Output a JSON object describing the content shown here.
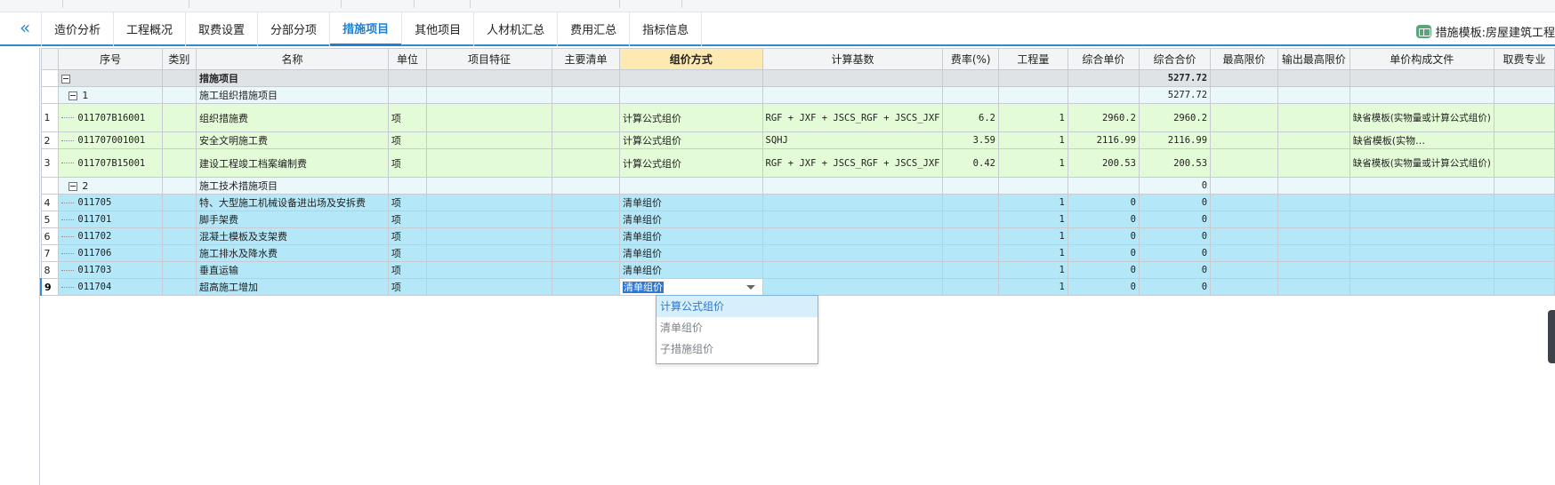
{
  "tabs": [
    {
      "label": "造价分析"
    },
    {
      "label": "工程概况"
    },
    {
      "label": "取费设置"
    },
    {
      "label": "分部分项"
    },
    {
      "label": "措施项目",
      "active": true
    },
    {
      "label": "其他项目"
    },
    {
      "label": "人材机汇总"
    },
    {
      "label": "费用汇总"
    },
    {
      "label": "指标信息"
    }
  ],
  "collapse_glyph": "«",
  "template_label": "措施模板:房屋建筑工程",
  "columns": {
    "seq": "序号",
    "category": "类别",
    "name": "名称",
    "unit": "单位",
    "feature": "项目特征",
    "main_list": "主要清单",
    "pricing": "组价方式",
    "base": "计算基数",
    "rate": "费率(%)",
    "qty": "工程量",
    "unit_price": "综合单价",
    "total": "综合合价",
    "max_limit": "最高限价",
    "out_max_limit": "输出最高限价",
    "composition": "单价构成文件",
    "fee_major": "取费专业"
  },
  "rows": {
    "root": {
      "name": "措施项目",
      "total": "5277.72"
    },
    "g1": {
      "code": "1",
      "name": "施工组织措施项目",
      "total": "5277.72"
    },
    "r1": {
      "idx": "1",
      "code": "011707B16001",
      "name": "组织措施费",
      "unit": "项",
      "pricing": "计算公式组价",
      "base": "RGF + JXF + JSCS_RGF + JSCS_JXF",
      "rate": "6.2",
      "qty": "1",
      "unit_price": "2960.2",
      "total": "2960.2",
      "composition": "缺省模板(实物量或计算公式组价)"
    },
    "r2": {
      "idx": "2",
      "code": "011707001001",
      "name": "安全文明施工费",
      "unit": "项",
      "pricing": "计算公式组价",
      "base": "SQHJ",
      "rate": "3.59",
      "qty": "1",
      "unit_price": "2116.99",
      "total": "2116.99",
      "composition": "缺省模板(实物…"
    },
    "r3": {
      "idx": "3",
      "code": "011707B15001",
      "name": "建设工程竣工档案编制费",
      "unit": "项",
      "pricing": "计算公式组价",
      "base": "RGF + JXF + JSCS_RGF + JSCS_JXF",
      "rate": "0.42",
      "qty": "1",
      "unit_price": "200.53",
      "total": "200.53",
      "composition": "缺省模板(实物量或计算公式组价)"
    },
    "g2": {
      "code": "2",
      "name": "施工技术措施项目",
      "total": "0"
    },
    "r4": {
      "idx": "4",
      "code": "011705",
      "name": "特、大型施工机械设备进出场及安拆费",
      "unit": "项",
      "pricing": "清单组价",
      "qty": "1",
      "unit_price": "0",
      "total": "0"
    },
    "r5": {
      "idx": "5",
      "code": "011701",
      "name": "脚手架费",
      "unit": "项",
      "pricing": "清单组价",
      "qty": "1",
      "unit_price": "0",
      "total": "0"
    },
    "r6": {
      "idx": "6",
      "code": "011702",
      "name": "混凝土模板及支架费",
      "unit": "项",
      "pricing": "清单组价",
      "qty": "1",
      "unit_price": "0",
      "total": "0"
    },
    "r7": {
      "idx": "7",
      "code": "011706",
      "name": "施工排水及降水费",
      "unit": "项",
      "pricing": "清单组价",
      "qty": "1",
      "unit_price": "0",
      "total": "0"
    },
    "r8": {
      "idx": "8",
      "code": "011703",
      "name": "垂直运输",
      "unit": "项",
      "pricing": "清单组价",
      "qty": "1",
      "unit_price": "0",
      "total": "0"
    },
    "r9": {
      "idx": "9",
      "code": "011704",
      "name": "超高施工增加",
      "unit": "项",
      "pricing": "清单组价",
      "qty": "1",
      "unit_price": "0",
      "total": "0"
    }
  },
  "dropdown": {
    "options": [
      "计算公式组价",
      "清单组价",
      "子措施组价"
    ]
  },
  "colors": {
    "accent": "#2f8ad8",
    "fee_row": "#e3fbd6",
    "measure_row": "#b4e8f8",
    "group_row": "#eaf7fb"
  }
}
